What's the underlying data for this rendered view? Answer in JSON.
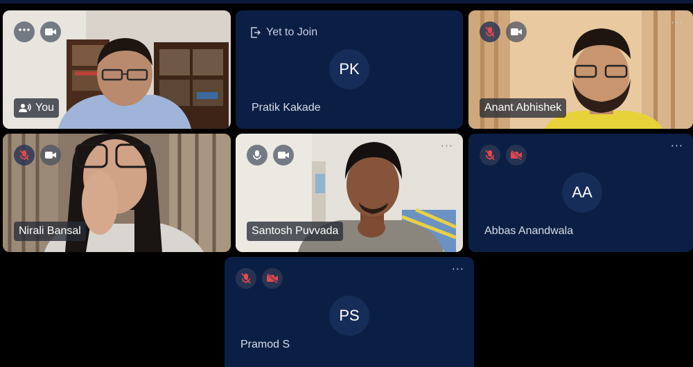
{
  "participants": [
    {
      "name": "You",
      "type": "video",
      "audio": "speaker",
      "video": "on",
      "menu_icon": "more-dots-icon"
    },
    {
      "name": "Pratik Kakade",
      "type": "pending",
      "initials": "PK",
      "status": "Yet to Join"
    },
    {
      "name": "Anant Abhishek",
      "type": "video",
      "audio": "muted",
      "video": "on"
    },
    {
      "name": "Nirali Bansal",
      "type": "video",
      "audio": "muted",
      "video": "on"
    },
    {
      "name": "Santosh Puvvada",
      "type": "video",
      "audio": "on",
      "video": "on"
    },
    {
      "name": "Abbas Anandwala",
      "type": "avatar",
      "initials": "AA",
      "audio": "muted",
      "video": "off"
    },
    {
      "name": "Pramod S",
      "type": "avatar",
      "initials": "PS",
      "audio": "muted",
      "video": "off"
    }
  ],
  "colors": {
    "tile_bg": "#0b1f45",
    "avatar_bg": "#172d59",
    "muted_red": "#e5484d",
    "page_bg": "#000000"
  }
}
